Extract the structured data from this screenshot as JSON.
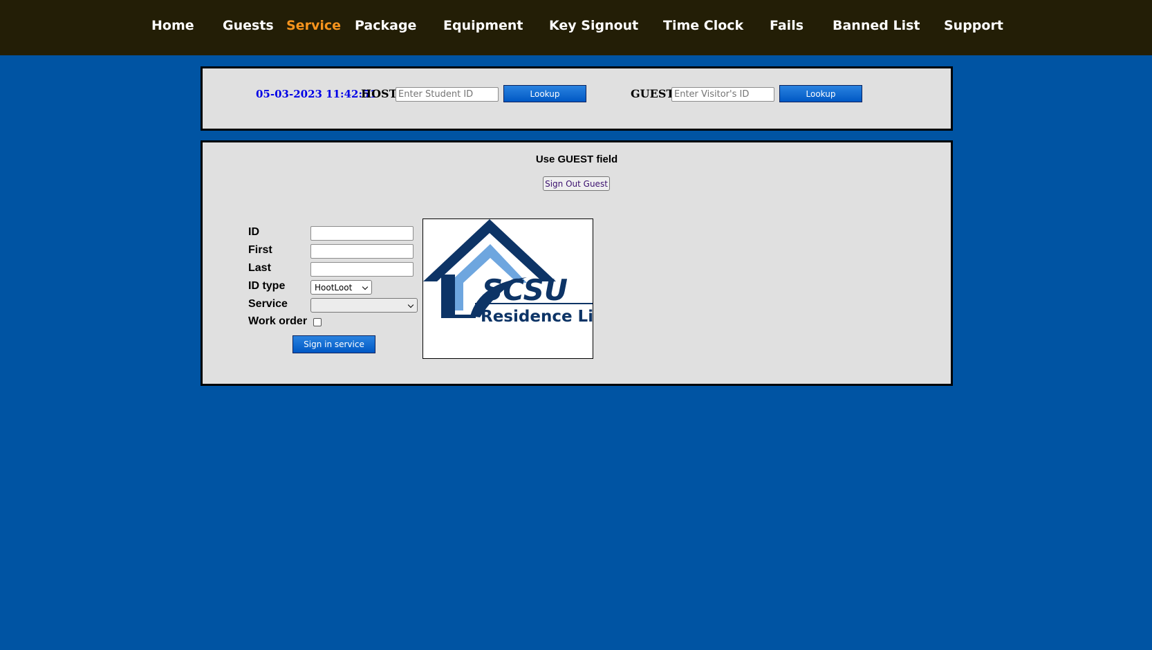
{
  "nav": {
    "items": [
      {
        "label": "Home"
      },
      {
        "label": "Guests"
      },
      {
        "label": "Service"
      },
      {
        "label": "Package"
      },
      {
        "label": "Equipment"
      },
      {
        "label": "Key Signout"
      },
      {
        "label": "Time Clock"
      },
      {
        "label": "Fails"
      },
      {
        "label": "Banned List"
      },
      {
        "label": "Support"
      }
    ],
    "active": "Service",
    "background_color": "#231e06",
    "active_color": "#f7941d"
  },
  "lookup": {
    "datetime": "05-03-2023 11:42:51",
    "host": {
      "label": "HOST",
      "placeholder": "Enter Student ID",
      "button_label": "Lookup"
    },
    "guest": {
      "label": "GUEST",
      "placeholder": "Enter Visitor's ID",
      "button_label": "Lookup"
    }
  },
  "service_panel": {
    "instruction": "Use GUEST field",
    "sign_out_label": "Sign Out Guest",
    "form": {
      "id_label": "ID",
      "first_label": "First",
      "last_label": "Last",
      "id_type_label": "ID type",
      "id_type_value": "HootLoot",
      "service_label": "Service",
      "service_value": "",
      "work_order_label": "Work order",
      "work_order_checked": false,
      "submit_label": "Sign in service"
    },
    "logo": {
      "brand": "SCSU",
      "subtitle": "Residence Life",
      "icon": "house-logo"
    }
  },
  "colors": {
    "page_background": "#0054a3",
    "panel_background": "#e0e0e0",
    "button_blue": "#0a64cc",
    "datetime_color": "#0000e6",
    "logo_dark": "#0d3466",
    "logo_light": "#6ea6df"
  }
}
